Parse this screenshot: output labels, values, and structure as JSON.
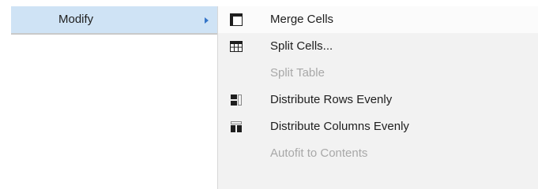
{
  "parent_menu": {
    "active_item": {
      "label": "Modify",
      "icon": "chevron-right-icon"
    }
  },
  "submenu": {
    "items": [
      {
        "label": "Merge Cells",
        "icon": "merge-cells-icon",
        "enabled": true,
        "highlighted": true
      },
      {
        "label": "Split Cells...",
        "icon": "split-cells-icon",
        "enabled": true
      },
      {
        "label": "Split Table",
        "icon": "",
        "enabled": false
      },
      {
        "label": "Distribute Rows Evenly",
        "icon": "distribute-rows-icon",
        "enabled": true
      },
      {
        "label": "Distribute Columns Evenly",
        "icon": "distribute-columns-icon",
        "enabled": true
      },
      {
        "label": "Autofit to Contents",
        "icon": "",
        "enabled": false
      }
    ]
  },
  "colors": {
    "parent_highlight": "#cfe3f5",
    "submenu_bg": "#f2f2f2",
    "disabled_text": "#a8a8a8",
    "arrow": "#3575c8"
  }
}
